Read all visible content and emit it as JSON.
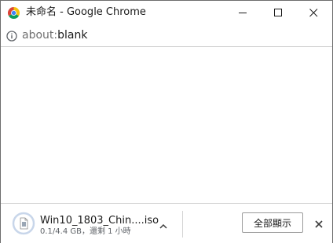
{
  "window": {
    "title": "未命名 - Google Chrome"
  },
  "addressbar": {
    "url_scheme": "about:",
    "url_path": "blank"
  },
  "download_shelf": {
    "file_name": "Win10_1803_Chin....iso",
    "status": "0.1/4.4 GB，還剩 1 小時",
    "show_all_label": "全部顯示"
  },
  "colors": {
    "chrome_red": "#db4437",
    "chrome_yellow": "#f4c20d",
    "chrome_green": "#0f9d58",
    "chrome_blue": "#4285f4"
  },
  "icons": {
    "app": "chrome-logo-icon",
    "minimize": "minimize-icon",
    "maximize": "maximize-icon",
    "close": "close-icon",
    "page_info": "info-icon",
    "file": "file-icon",
    "chevron": "chevron-up-icon",
    "shelf_close": "close-icon"
  }
}
